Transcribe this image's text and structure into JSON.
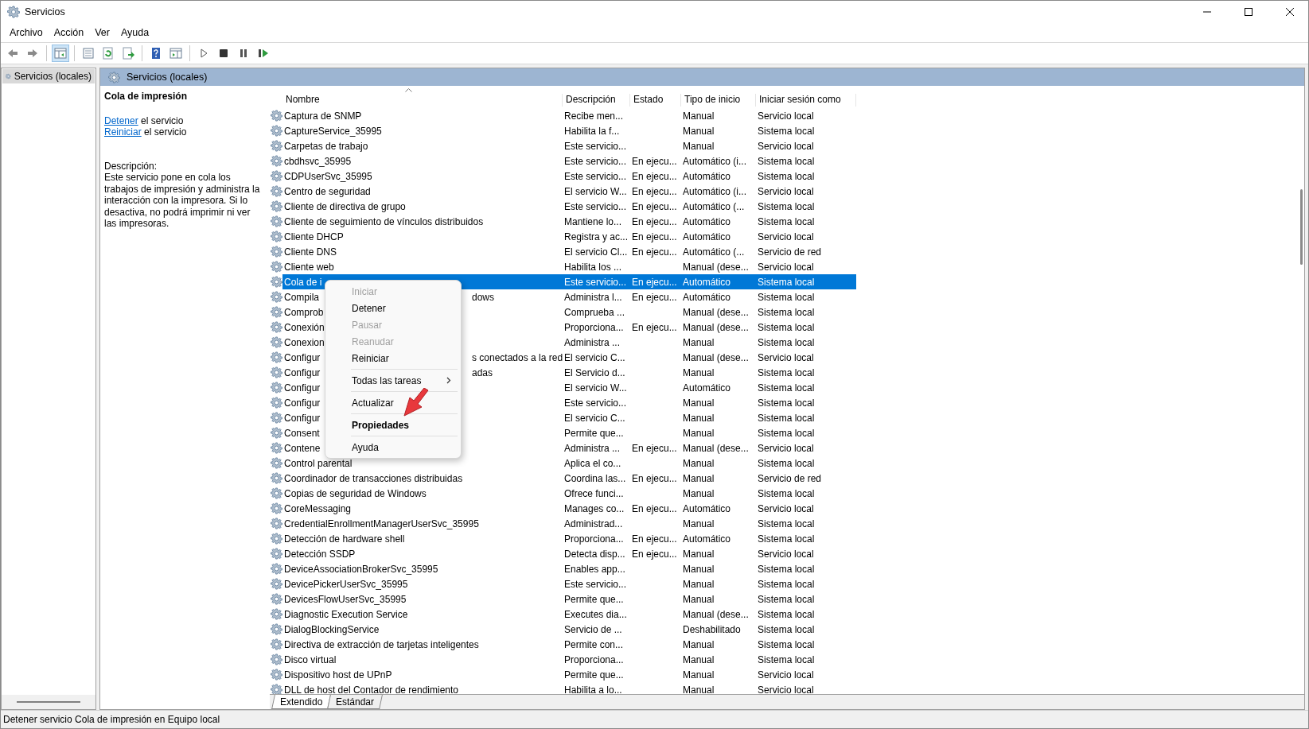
{
  "window": {
    "title": "Servicios"
  },
  "menu_bar": [
    "Archivo",
    "Acción",
    "Ver",
    "Ayuda"
  ],
  "tree": {
    "items": [
      {
        "label": "Servicios (locales)",
        "selected": true
      }
    ]
  },
  "panel": {
    "title": "Servicios (locales)"
  },
  "details": {
    "title": "Cola de impresión",
    "actions": [
      {
        "link": "Detener",
        "text": "el servicio"
      },
      {
        "link": "Reiniciar",
        "text": "el servicio"
      }
    ],
    "description_label": "Descripción:",
    "description": "Este servicio pone en cola los trabajos de impresión y administra la interacción con la impresora. Si lo desactiva, no podrá imprimir ni ver las impresoras."
  },
  "table": {
    "columns": [
      "Nombre",
      "Descripción",
      "Estado",
      "Tipo de inicio",
      "Iniciar sesión como"
    ],
    "rows": [
      {
        "name": "Captura de SNMP",
        "description": "Recibe men...",
        "status": "",
        "startup": "Manual",
        "logon": "Servicio local",
        "selected": false
      },
      {
        "name": "CaptureService_35995",
        "description": "Habilita la f...",
        "status": "",
        "startup": "Manual",
        "logon": "Sistema local",
        "selected": false
      },
      {
        "name": "Carpetas de trabajo",
        "description": "Este servicio...",
        "status": "",
        "startup": "Manual",
        "logon": "Servicio local",
        "selected": false
      },
      {
        "name": "cbdhsvc_35995",
        "description": "Este servicio...",
        "status": "En ejecu...",
        "startup": "Automático (i...",
        "logon": "Sistema local",
        "selected": false
      },
      {
        "name": "CDPUserSvc_35995",
        "description": "Este servicio...",
        "status": "En ejecu...",
        "startup": "Automático",
        "logon": "Sistema local",
        "selected": false
      },
      {
        "name": "Centro de seguridad",
        "description": "El servicio W...",
        "status": "En ejecu...",
        "startup": "Automático (i...",
        "logon": "Servicio local",
        "selected": false
      },
      {
        "name": "Cliente de directiva de grupo",
        "description": "Este servicio...",
        "status": "En ejecu...",
        "startup": "Automático (...",
        "logon": "Sistema local",
        "selected": false
      },
      {
        "name": "Cliente de seguimiento de vínculos distribuidos",
        "description": "Mantiene lo...",
        "status": "En ejecu...",
        "startup": "Automático",
        "logon": "Sistema local",
        "selected": false
      },
      {
        "name": "Cliente DHCP",
        "description": "Registra y ac...",
        "status": "En ejecu...",
        "startup": "Automático",
        "logon": "Servicio local",
        "selected": false
      },
      {
        "name": "Cliente DNS",
        "description": "El servicio Cl...",
        "status": "En ejecu...",
        "startup": "Automático (...",
        "logon": "Servicio de red",
        "selected": false
      },
      {
        "name": "Cliente web",
        "description": "Habilita los ...",
        "status": "",
        "startup": "Manual (dese...",
        "logon": "Servicio local",
        "selected": false
      },
      {
        "name": "Cola de i",
        "description": "Este servicio...",
        "status": "En ejecu...",
        "startup": "Automático",
        "logon": "Sistema local",
        "selected": true
      },
      {
        "name": "Compila",
        "name_tail": "dows",
        "description": "Administra l...",
        "status": "En ejecu...",
        "startup": "Automático",
        "logon": "Sistema local",
        "selected": false
      },
      {
        "name": "Comprob",
        "description": "Comprueba ...",
        "status": "",
        "startup": "Manual (dese...",
        "logon": "Sistema local",
        "selected": false
      },
      {
        "name": "Conexión",
        "description": "Proporciona...",
        "status": "En ejecu...",
        "startup": "Manual (dese...",
        "logon": "Sistema local",
        "selected": false
      },
      {
        "name": "Conexion",
        "description": "Administra ...",
        "status": "",
        "startup": "Manual",
        "logon": "Sistema local",
        "selected": false
      },
      {
        "name": "Configur",
        "name_tail": "s conectados a la red",
        "description": "El servicio C...",
        "status": "",
        "startup": "Manual (dese...",
        "logon": "Servicio local",
        "selected": false
      },
      {
        "name": "Configur",
        "name_tail": "adas",
        "description": "El Servicio d...",
        "status": "",
        "startup": "Manual",
        "logon": "Sistema local",
        "selected": false
      },
      {
        "name": "Configur",
        "description": "El servicio W...",
        "status": "",
        "startup": "Automático",
        "logon": "Sistema local",
        "selected": false
      },
      {
        "name": "Configur",
        "description": "Este servicio...",
        "status": "",
        "startup": "Manual",
        "logon": "Sistema local",
        "selected": false
      },
      {
        "name": "Configur",
        "description": "El servicio C...",
        "status": "",
        "startup": "Manual",
        "logon": "Sistema local",
        "selected": false
      },
      {
        "name": "Consent",
        "description": "Permite que...",
        "status": "",
        "startup": "Manual",
        "logon": "Sistema local",
        "selected": false
      },
      {
        "name": "Contene",
        "description": "Administra ...",
        "status": "En ejecu...",
        "startup": "Manual (dese...",
        "logon": "Servicio local",
        "selected": false
      },
      {
        "name": "Control parental",
        "description": "Aplica el co...",
        "status": "",
        "startup": "Manual",
        "logon": "Sistema local",
        "selected": false
      },
      {
        "name": "Coordinador de transacciones distribuidas",
        "description": "Coordina las...",
        "status": "En ejecu...",
        "startup": "Manual",
        "logon": "Servicio de red",
        "selected": false
      },
      {
        "name": "Copias de seguridad de Windows",
        "description": "Ofrece funci...",
        "status": "",
        "startup": "Manual",
        "logon": "Sistema local",
        "selected": false
      },
      {
        "name": "CoreMessaging",
        "description": "Manages co...",
        "status": "En ejecu...",
        "startup": "Automático",
        "logon": "Servicio local",
        "selected": false
      },
      {
        "name": "CredentialEnrollmentManagerUserSvc_35995",
        "description": "Administrad...",
        "status": "",
        "startup": "Manual",
        "logon": "Sistema local",
        "selected": false
      },
      {
        "name": "Detección de hardware shell",
        "description": "Proporciona...",
        "status": "En ejecu...",
        "startup": "Automático",
        "logon": "Sistema local",
        "selected": false
      },
      {
        "name": "Detección SSDP",
        "description": "Detecta disp...",
        "status": "En ejecu...",
        "startup": "Manual",
        "logon": "Servicio local",
        "selected": false
      },
      {
        "name": "DeviceAssociationBrokerSvc_35995",
        "description": "Enables app...",
        "status": "",
        "startup": "Manual",
        "logon": "Sistema local",
        "selected": false
      },
      {
        "name": "DevicePickerUserSvc_35995",
        "description": "Este servicio...",
        "status": "",
        "startup": "Manual",
        "logon": "Sistema local",
        "selected": false
      },
      {
        "name": "DevicesFlowUserSvc_35995",
        "description": "Permite que...",
        "status": "",
        "startup": "Manual",
        "logon": "Sistema local",
        "selected": false
      },
      {
        "name": "Diagnostic Execution Service",
        "description": "Executes dia...",
        "status": "",
        "startup": "Manual (dese...",
        "logon": "Sistema local",
        "selected": false
      },
      {
        "name": "DialogBlockingService",
        "description": "Servicio de ...",
        "status": "",
        "startup": "Deshabilitado",
        "logon": "Sistema local",
        "selected": false
      },
      {
        "name": "Directiva de extracción de tarjetas inteligentes",
        "description": "Permite con...",
        "status": "",
        "startup": "Manual",
        "logon": "Sistema local",
        "selected": false
      },
      {
        "name": "Disco virtual",
        "description": "Proporciona...",
        "status": "",
        "startup": "Manual",
        "logon": "Sistema local",
        "selected": false
      },
      {
        "name": "Dispositivo host de UPnP",
        "description": "Permite que...",
        "status": "",
        "startup": "Manual",
        "logon": "Servicio local",
        "selected": false
      },
      {
        "name": "DLL de host del Contador de rendimiento",
        "description": "Habilita a lo...",
        "status": "",
        "startup": "Manual",
        "logon": "Servicio local",
        "selected": false
      }
    ]
  },
  "context_menu": {
    "items": [
      {
        "kind": "item",
        "label": "Iniciar",
        "disabled": true
      },
      {
        "kind": "item",
        "label": "Detener",
        "disabled": false
      },
      {
        "kind": "item",
        "label": "Pausar",
        "disabled": true
      },
      {
        "kind": "item",
        "label": "Reanudar",
        "disabled": true
      },
      {
        "kind": "item",
        "label": "Reiniciar",
        "disabled": false
      },
      {
        "kind": "separator"
      },
      {
        "kind": "submenu",
        "label": "Todas las tareas",
        "disabled": false
      },
      {
        "kind": "separator"
      },
      {
        "kind": "item",
        "label": "Actualizar",
        "disabled": false
      },
      {
        "kind": "separator"
      },
      {
        "kind": "default",
        "label": "Propiedades",
        "disabled": false
      },
      {
        "kind": "separator"
      },
      {
        "kind": "item",
        "label": "Ayuda",
        "disabled": false
      }
    ]
  },
  "view_tabs": [
    {
      "label": "Extendido",
      "selected": true
    },
    {
      "label": "Estándar",
      "selected": false
    }
  ],
  "status_bar": "Detener servicio Cola de impresión en Equipo local"
}
